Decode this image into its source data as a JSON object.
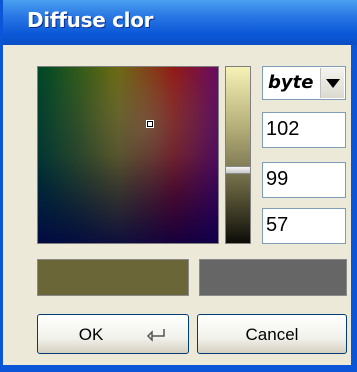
{
  "window": {
    "title": "Diffuse clor"
  },
  "mode_select": {
    "value": "byte"
  },
  "fields": {
    "red": "102",
    "green": "99",
    "blue": "57"
  },
  "swatches": {
    "new_color": "#6b6638",
    "old_color": "#666666"
  },
  "buttons": {
    "ok": "OK",
    "cancel": "Cancel"
  },
  "icons": {
    "ok_icon": "enter-key-icon",
    "dropdown": "chevron-down-icon"
  },
  "colors": {
    "title_bar": "#0a55d8",
    "dialog_bg": "#ece9d8",
    "selected_color": "#666639"
  }
}
